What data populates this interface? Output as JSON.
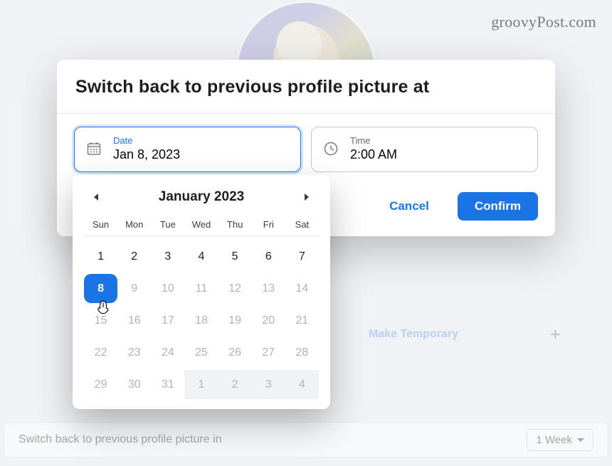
{
  "watermark": "groovyPost.com",
  "background": {
    "makeTempLabel": "Make Temporary",
    "plus": "+",
    "switchRow": {
      "label": "Switch back to previous profile picture in",
      "dropdownValue": "1 Week"
    }
  },
  "modal": {
    "title": "Switch back to previous profile picture at",
    "dateField": {
      "label": "Date",
      "value": "Jan 8, 2023"
    },
    "timeField": {
      "label": "Time",
      "value": "2:00 AM"
    },
    "actions": {
      "cancel": "Cancel",
      "confirm": "Confirm"
    }
  },
  "calendar": {
    "monthLabel": "January 2023",
    "dow": [
      "Sun",
      "Mon",
      "Tue",
      "Wed",
      "Thu",
      "Fri",
      "Sat"
    ],
    "weeks": [
      [
        {
          "n": "1",
          "state": "n"
        },
        {
          "n": "2",
          "state": "n"
        },
        {
          "n": "3",
          "state": "n"
        },
        {
          "n": "4",
          "state": "n"
        },
        {
          "n": "5",
          "state": "n"
        },
        {
          "n": "6",
          "state": "n"
        },
        {
          "n": "7",
          "state": "n"
        }
      ],
      [
        {
          "n": "8",
          "state": "sel"
        },
        {
          "n": "9",
          "state": "m"
        },
        {
          "n": "10",
          "state": "m"
        },
        {
          "n": "11",
          "state": "m"
        },
        {
          "n": "12",
          "state": "m"
        },
        {
          "n": "13",
          "state": "m"
        },
        {
          "n": "14",
          "state": "m"
        }
      ],
      [
        {
          "n": "15",
          "state": "m"
        },
        {
          "n": "16",
          "state": "m"
        },
        {
          "n": "17",
          "state": "m"
        },
        {
          "n": "18",
          "state": "m"
        },
        {
          "n": "19",
          "state": "m"
        },
        {
          "n": "20",
          "state": "m"
        },
        {
          "n": "21",
          "state": "m"
        }
      ],
      [
        {
          "n": "22",
          "state": "m"
        },
        {
          "n": "23",
          "state": "m"
        },
        {
          "n": "24",
          "state": "m"
        },
        {
          "n": "25",
          "state": "m"
        },
        {
          "n": "26",
          "state": "m"
        },
        {
          "n": "27",
          "state": "m"
        },
        {
          "n": "28",
          "state": "m"
        }
      ],
      [
        {
          "n": "29",
          "state": "m"
        },
        {
          "n": "30",
          "state": "m"
        },
        {
          "n": "31",
          "state": "m"
        },
        {
          "n": "1",
          "state": "o"
        },
        {
          "n": "2",
          "state": "o"
        },
        {
          "n": "3",
          "state": "o"
        },
        {
          "n": "4",
          "state": "o"
        }
      ]
    ]
  }
}
